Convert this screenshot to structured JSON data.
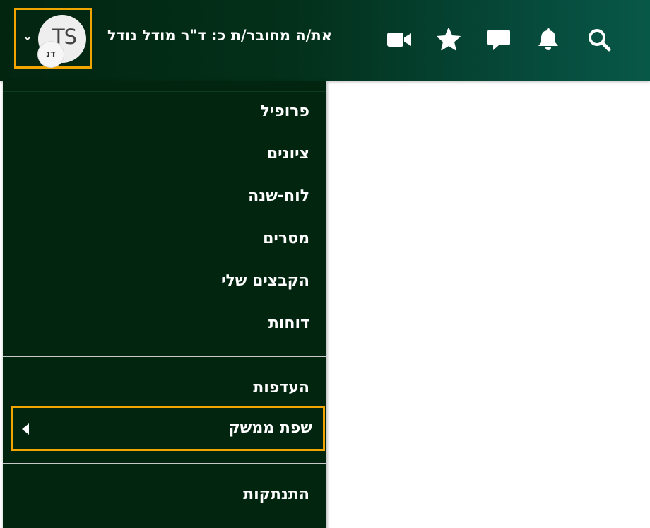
{
  "header": {
    "connected_as": "את/ה מחובר/ת כ: ד\"ר מודל נודל",
    "avatar_initials": "TS",
    "avatar_badge": "דנ",
    "icons": [
      "chevron-down-icon",
      "video-icon",
      "star-icon",
      "chat-icon",
      "bell-icon",
      "search-icon"
    ]
  },
  "menu": {
    "items": [
      "פרופיל",
      "ציונים",
      "לוח-שנה",
      "מסרים",
      "הקבצים שלי",
      "דוחות"
    ],
    "preferences": "העדפות",
    "language": "שפת ממשק",
    "logout": "התנתקות"
  },
  "colors": {
    "header_dark": "#022510",
    "header_light": "#085848",
    "menu_bg": "#022510",
    "highlight": "#f2a500",
    "text": "#ffffff"
  }
}
